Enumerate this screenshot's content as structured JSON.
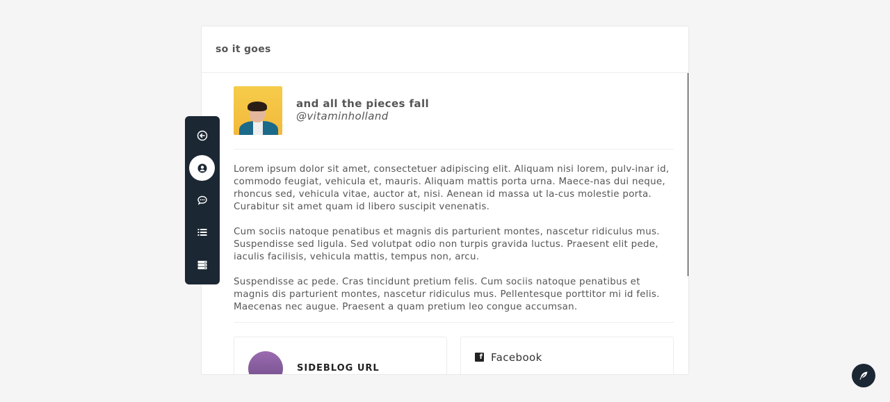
{
  "card": {
    "title": "so it goes"
  },
  "profile": {
    "name": "and all the pieces fall",
    "handle": "@vitaminholland"
  },
  "bio": {
    "paragraphs": [
      "Lorem ipsum dolor sit amet, consectetuer adipiscing elit. Aliquam nisi lorem, pulv-inar id, commodo feugiat, vehicula et, mauris. Aliquam mattis porta urna. Maece-nas dui neque, rhoncus sed, vehicula vitae, auctor at, nisi. Aenean id massa ut la-cus molestie porta. Curabitur sit amet quam id libero suscipit venenatis.",
      "Cum sociis natoque penatibus et magnis dis parturient montes, nascetur ridiculus mus. Suspendisse sed ligula. Sed volutpat odio non turpis gravida luctus. Praesent elit pede, iaculis facilisis, vehicula mattis, tempus non, arcu.",
      "Suspendisse ac pede. Cras tincidunt pretium felis. Cum sociis natoque penatibus et magnis dis parturient montes, nascetur ridiculus mus. Pellentesque porttitor mi id felis. Maecenas nec augue. Praesent a quam pretium leo congue accumsan."
    ]
  },
  "links": {
    "sideblog_label": "SIDEBLOG URL",
    "facebook_label": "Facebook"
  },
  "sidebar": {
    "items": [
      {
        "icon": "arrow-left-circle-icon",
        "active": false
      },
      {
        "icon": "user-circle-icon",
        "active": true
      },
      {
        "icon": "chat-bubble-icon",
        "active": false
      },
      {
        "icon": "list-icon",
        "active": false
      },
      {
        "icon": "server-icon",
        "active": false
      }
    ]
  },
  "fab": {
    "icon": "feather-icon"
  },
  "colors": {
    "sidebar_bg": "#1c2734",
    "background": "#f5f5f5"
  }
}
